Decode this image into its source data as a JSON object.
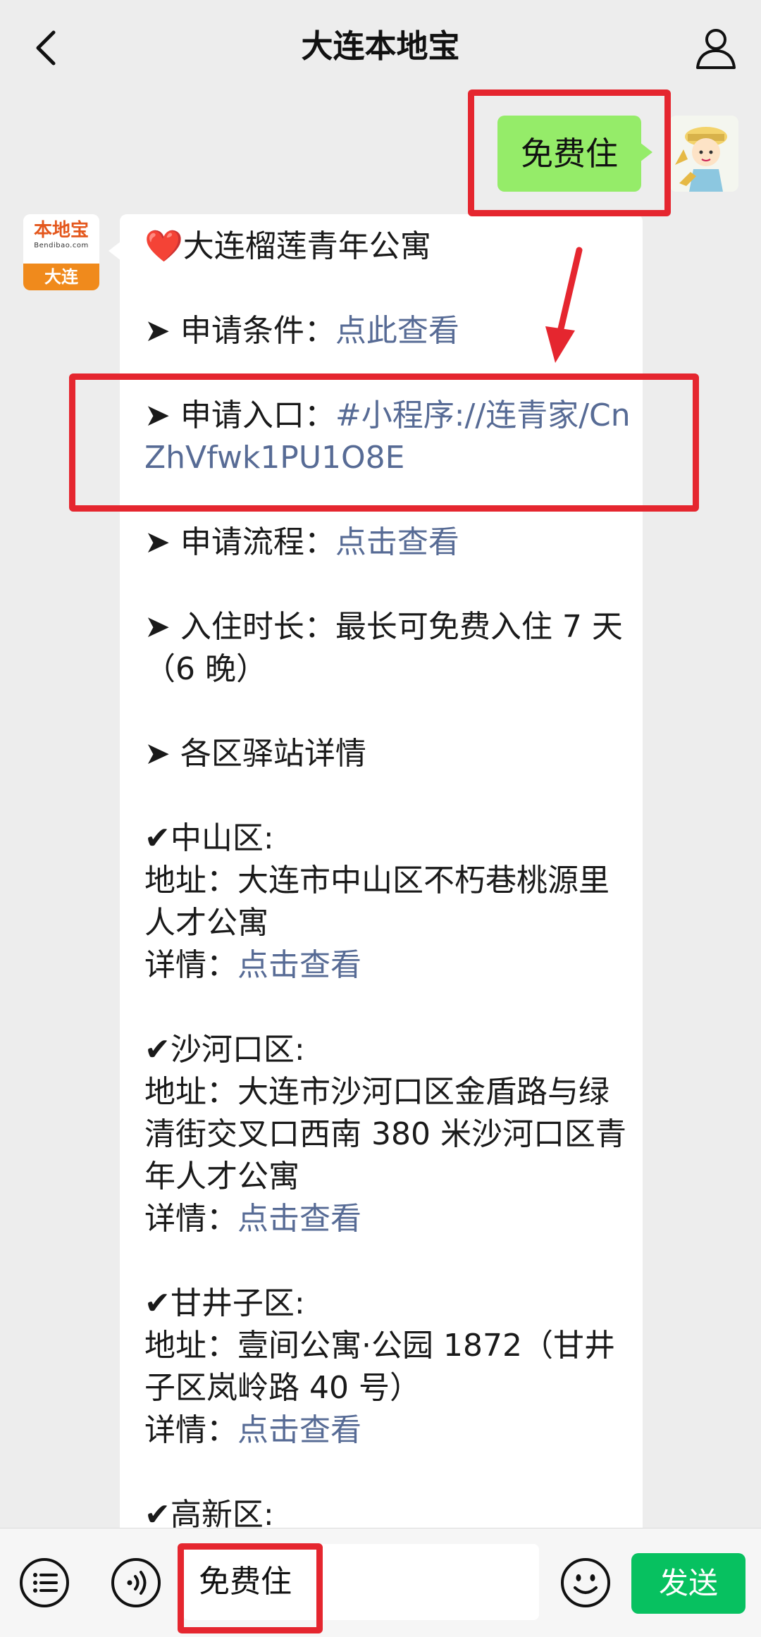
{
  "header": {
    "title": "大连本地宝"
  },
  "user_message": {
    "text": "免费住"
  },
  "bot": {
    "avatar_logo": "本地宝",
    "avatar_sub": "Bendibao.com",
    "avatar_city": "大连"
  },
  "message": {
    "heading": "❤️大连榴莲青年公寓",
    "cond_prefix": "➤ 申请条件：",
    "cond_link": "点此查看",
    "entry_prefix": "➤ 申请入口：",
    "entry_link": "#小程序://连青家/CnZhVfwk1PU1O8E",
    "flow_prefix": "➤ 申请流程：",
    "flow_link": "点击查看",
    "stay": "➤ 入住时长：最长可免费入住 7 天（6 晚）",
    "stations": "➤ 各区驿站详情",
    "zs_title": "✔中山区:",
    "zs_addr": "地址：大连市中山区不朽巷桃源里人才公寓",
    "detail_prefix": "详情：",
    "detail_link": "点击查看",
    "shk_title": "✔沙河口区:",
    "shk_addr": "地址：大连市沙河口区金盾路与绿清街交叉口西南 380 米沙河口区青年人才公寓",
    "gjz_title": "✔甘井子区:",
    "gjz_addr": "地址：壹间公寓·公园 1872（甘井子区岚岭路 40 号）",
    "gx_title": "✔高新区:"
  },
  "input_bar": {
    "value": "免费住",
    "send_label": "发送"
  },
  "colors": {
    "bubble_green": "#95ec69",
    "link_blue": "#576b95",
    "send_green": "#07c160",
    "annotation_red": "#e5262f"
  }
}
